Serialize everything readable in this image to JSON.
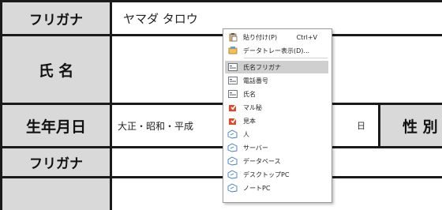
{
  "form": {
    "furigana_label": "フリガナ",
    "furigana_value": "ヤマダ タロウ",
    "name_label": "氏 名",
    "birth_label": "生年月日",
    "era_options": "大正・昭和・平成",
    "day_unit": "日",
    "gender_label": "性 別",
    "furigana_label_2": "フリガナ"
  },
  "context_menu": {
    "paste": "貼り付け(P)",
    "paste_shortcut": "Ctrl+V",
    "data_tray": "データトレー表示(D)...",
    "items": [
      {
        "label": "氏名フリガナ",
        "icon": "field-icon"
      },
      {
        "label": "電話番号",
        "icon": "field-icon"
      },
      {
        "label": "氏名",
        "icon": "field-icon"
      },
      {
        "label": "マル秘",
        "icon": "stamp-icon"
      },
      {
        "label": "見本",
        "icon": "stamp-icon"
      },
      {
        "label": "人",
        "icon": "clip-icon"
      },
      {
        "label": "サーバー",
        "icon": "clip-icon"
      },
      {
        "label": "データベース",
        "icon": "clip-icon"
      },
      {
        "label": "デスクトップPC",
        "icon": "clip-icon"
      },
      {
        "label": "ノートPC",
        "icon": "clip-icon"
      }
    ],
    "highlighted_item": "氏名フリガナ"
  }
}
